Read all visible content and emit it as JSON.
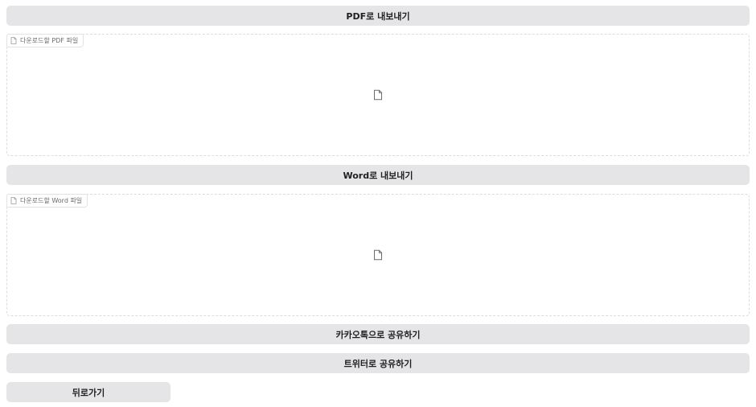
{
  "export_pdf": {
    "button_label": "PDF로 내보내기",
    "file_label": "다운로드할 PDF 파일",
    "icon": "file-icon"
  },
  "export_word": {
    "button_label": "Word로 내보내기",
    "file_label": "다운로드할 Word 파일",
    "icon": "file-icon"
  },
  "share": {
    "kakao_label": "카카오톡으로 공유하기",
    "twitter_label": "트위터로 공유하기"
  },
  "nav": {
    "back_label": "뒤로가기"
  },
  "colors": {
    "button_bg": "#e5e5e7",
    "border": "#dcdcdf",
    "label_text": "#6b6b70"
  }
}
